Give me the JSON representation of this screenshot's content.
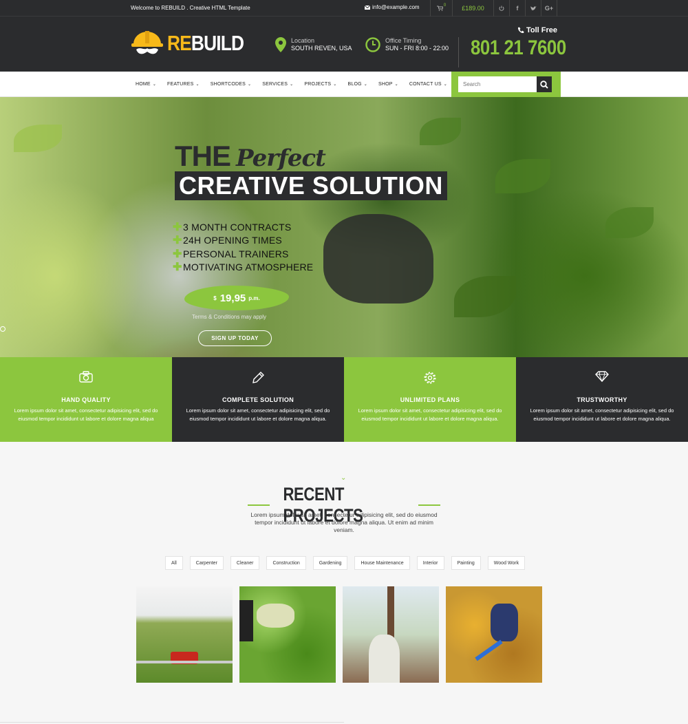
{
  "topbar": {
    "welcome": "Welcome to REBUILD . Creative HTML Template",
    "email": "info@example.com",
    "cart_count": "0",
    "cart_total": "£189.00"
  },
  "header": {
    "logo_re": "RE",
    "logo_build": "BUILD",
    "location_label": "Location",
    "location_value": "SOUTH REVEN, USA",
    "timing_label": "Office Timing",
    "timing_value": "SUN - FRI 8:00 - 22:00",
    "toll_free_label": "Toll Free",
    "phone": "801 21 7600"
  },
  "nav": {
    "items": [
      "HOME",
      "FEATURES",
      "SHORTCODES",
      "SERVICES",
      "PROJECTS",
      "BLOG",
      "SHOP",
      "CONTACT US"
    ],
    "search_placeholder": "Search"
  },
  "hero": {
    "title_the": "THE",
    "title_perfect": "Perfect",
    "title_line2": "CREATIVE SOLUTION",
    "features": [
      "3 MONTH CONTRACTS",
      "24H OPENING TIMES",
      "PERSONAL TRAINERS",
      "MOTIVATING ATMOSPHERE"
    ],
    "price_currency": "$",
    "price_amount": "19,95",
    "price_period": "p.m.",
    "terms": "Terms & Conditions may apply",
    "signup": "SIGN UP TODAY"
  },
  "boxes": [
    {
      "icon": "camera-icon",
      "title": "HAND QUALITY",
      "text": "Lorem ipsum dolor sit amet, consectetur adipisicing elit, sed do eiusmod tempor incididunt ut labore et dolore magna aliqua"
    },
    {
      "icon": "pencil-icon",
      "title": "COMPLETE SOLUTION",
      "text": "Lorem ipsum dolor sit amet, consectetur adipisicing elit, sed do eiusmod tempor incididunt ut labore et dolore magna aliqua."
    },
    {
      "icon": "gear-icon",
      "title": "UNLIMITED PLANS",
      "text": "Lorem ipsum dolor sit amet, consectetur adipisicing elit, sed do eiusmod tempor incididunt ut labore et dolore magna aliqua."
    },
    {
      "icon": "diamond-icon",
      "title": "TRUSTWORTHY",
      "text": "Lorem ipsum dolor sit amet, consectetur adipisicing elit, sed do eiusmod tempor incididunt ut labore et dolore magna aliqua."
    }
  ],
  "recent": {
    "title": "RECENT PROJECTS",
    "description": "Lorem ipsum dolor sit amet, consectetur adipisicing elit, sed do eiusmod tempor incididunt ut labore et dolore magna aliqua. Ut enim ad minim veniam.",
    "filters": [
      "All",
      "Carpenter",
      "Cleaner",
      "Construction",
      "Gardening",
      "House Maintenance",
      "Interior",
      "Painting",
      "Wood Work"
    ]
  },
  "colors": {
    "accent": "#8cc63e",
    "dark": "#2b2c2e",
    "logo_yellow": "#f7b91a"
  }
}
